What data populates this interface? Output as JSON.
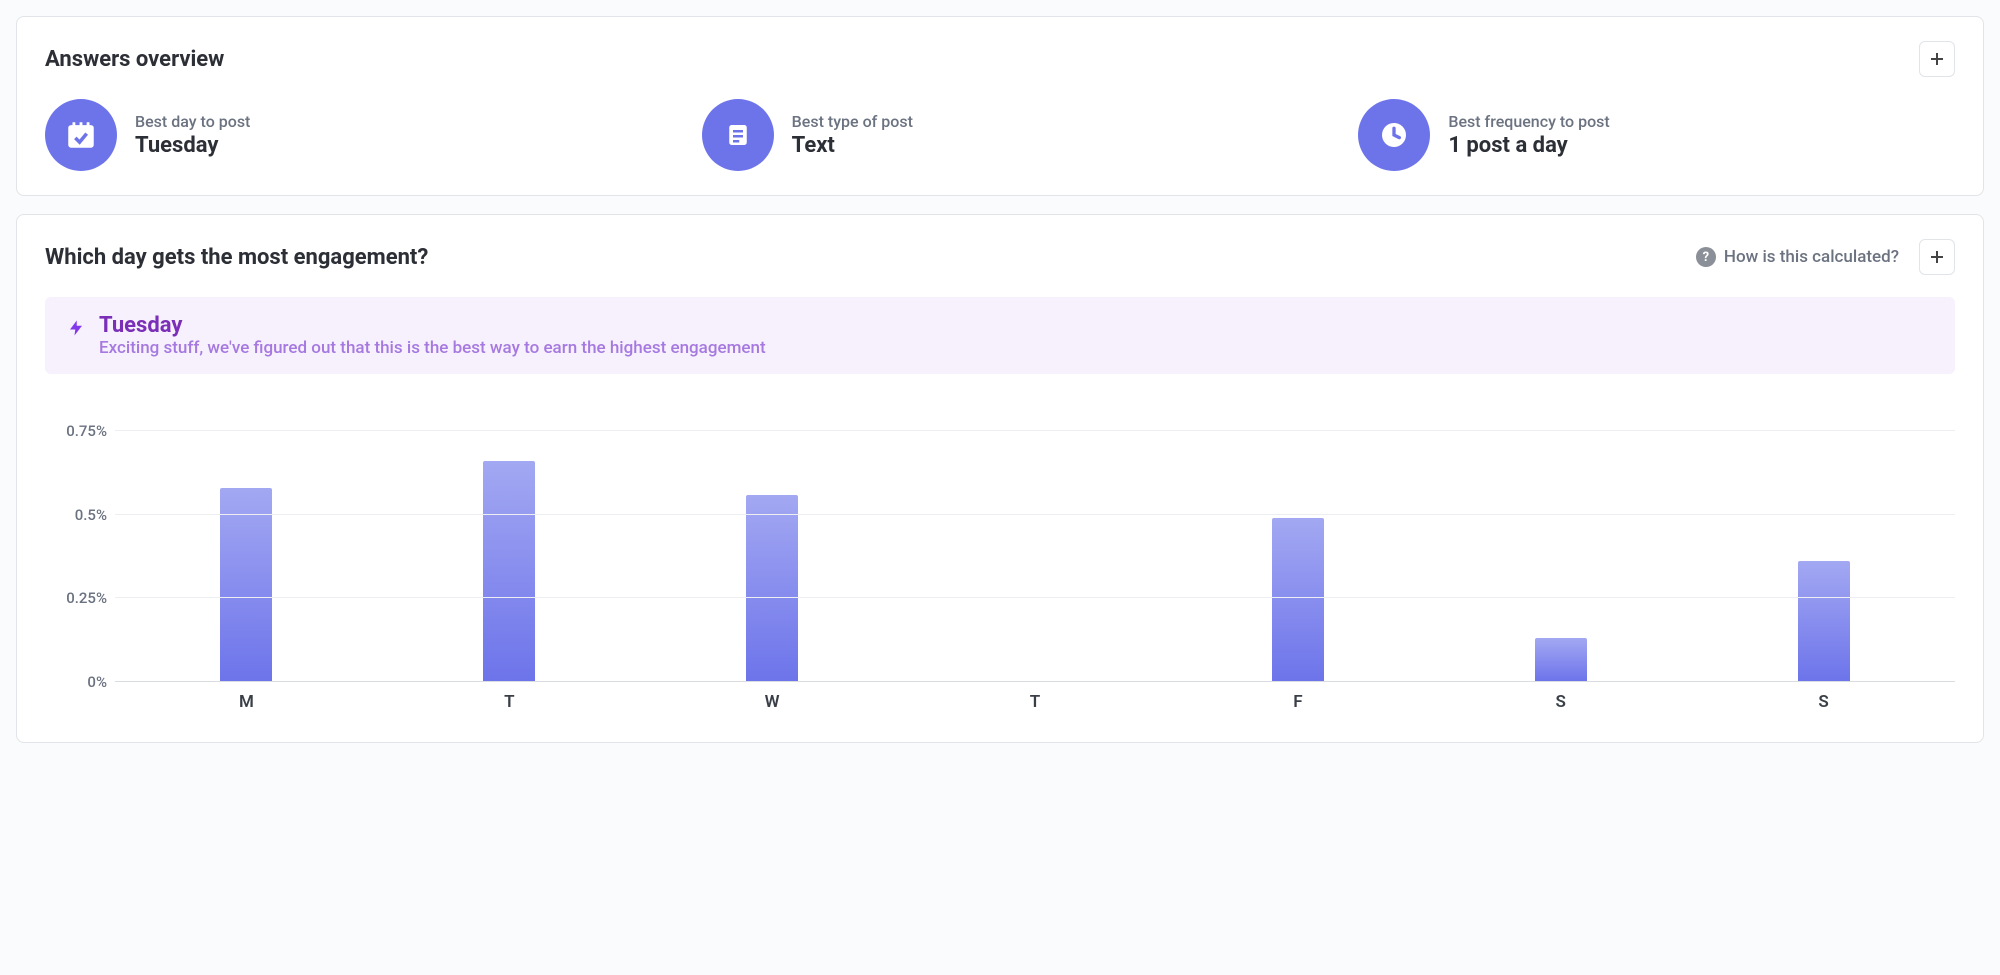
{
  "overview": {
    "title": "Answers overview",
    "metrics": [
      {
        "label": "Best day to post",
        "value": "Tuesday",
        "icon": "calendar-check-icon"
      },
      {
        "label": "Best type of post",
        "value": "Text",
        "icon": "document-icon"
      },
      {
        "label": "Best frequency to post",
        "value": "1 post a day",
        "icon": "clock-icon"
      }
    ]
  },
  "engagement": {
    "title": "Which day gets the most engagement?",
    "help_label": "How is this calculated?",
    "highlight_day": "Tuesday",
    "highlight_sub": "Exciting stuff, we've figured out that this is the best way to earn the highest engagement"
  },
  "chart_data": {
    "type": "bar",
    "categories": [
      "M",
      "T",
      "W",
      "T",
      "F",
      "S",
      "S"
    ],
    "values": [
      0.58,
      0.66,
      0.56,
      0.0,
      0.49,
      0.13,
      0.36
    ],
    "ylabel": "",
    "xlabel": "",
    "ylim": [
      0,
      0.85
    ],
    "yticks": [
      0,
      0.25,
      0.5,
      0.75
    ],
    "ytick_labels": [
      "0%",
      "0.25%",
      "0.5%",
      "0.75%"
    ],
    "title": ""
  },
  "colors": {
    "accent": "#6d74ea",
    "highlight_bg": "#f6f1fc",
    "highlight_text": "#7b2fb8"
  }
}
